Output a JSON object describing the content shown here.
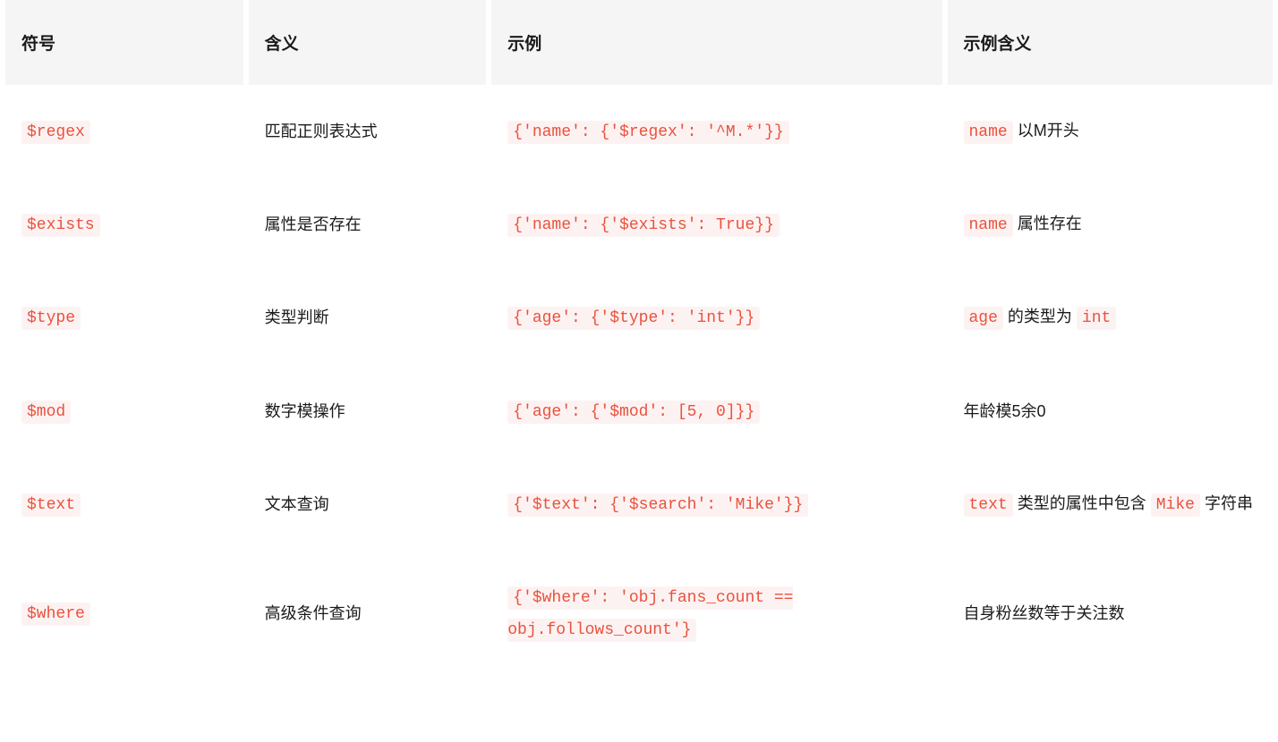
{
  "headers": {
    "symbol": "符号",
    "meaning": "含义",
    "example": "示例",
    "example_meaning": "示例含义"
  },
  "rows": [
    {
      "symbol": "$regex",
      "meaning": "匹配正则表达式",
      "example": "{'name': {'$regex': '^M.*'}}",
      "desc_parts": [
        {
          "type": "code",
          "text": "name"
        },
        {
          "type": "text",
          "text": " 以M开头"
        }
      ]
    },
    {
      "symbol": "$exists",
      "meaning": "属性是否存在",
      "example": "{'name': {'$exists': True}}",
      "desc_parts": [
        {
          "type": "code",
          "text": "name"
        },
        {
          "type": "text",
          "text": " 属性存在"
        }
      ]
    },
    {
      "symbol": "$type",
      "meaning": "类型判断",
      "example": "{'age': {'$type': 'int'}}",
      "desc_parts": [
        {
          "type": "code",
          "text": "age"
        },
        {
          "type": "text",
          "text": " 的类型为 "
        },
        {
          "type": "code",
          "text": "int"
        }
      ]
    },
    {
      "symbol": "$mod",
      "meaning": "数字模操作",
      "example": "{'age': {'$mod': [5, 0]}}",
      "desc_parts": [
        {
          "type": "text",
          "text": "年龄模5余0"
        }
      ]
    },
    {
      "symbol": "$text",
      "meaning": "文本查询",
      "example": "{'$text': {'$search': 'Mike'}}",
      "desc_parts": [
        {
          "type": "code",
          "text": "text"
        },
        {
          "type": "text",
          "text": " 类型的属性中包含 "
        },
        {
          "type": "code",
          "text": "Mike"
        },
        {
          "type": "text",
          "text": " 字符串"
        }
      ]
    },
    {
      "symbol": "$where",
      "meaning": "高级条件查询",
      "example": "{'$where': 'obj.fans_count == obj.follows_count'}",
      "desc_parts": [
        {
          "type": "text",
          "text": "自身粉丝数等于关注数"
        }
      ]
    }
  ]
}
